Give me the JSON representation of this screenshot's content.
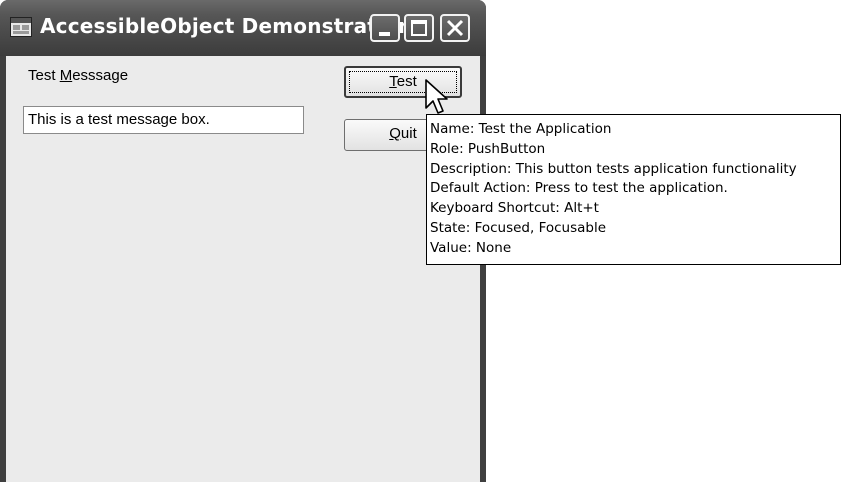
{
  "window": {
    "title": "AccessibleObject Demonstration"
  },
  "form": {
    "label_prefix": "Test ",
    "label_accel": "M",
    "label_rest": "esssage",
    "textbox_value": "This is a test message box.",
    "test_button_accel": "T",
    "test_button_rest": "est",
    "quit_button_accel": "Q",
    "quit_button_rest": "uit"
  },
  "tooltip": {
    "lines": [
      "Name: Test the Application",
      "Role: PushButton",
      "Description: This button tests application functionality",
      "Default Action: Press to test the application.",
      "Keyboard Shortcut: Alt+t",
      "State: Focused, Focusable",
      "Value: None"
    ]
  },
  "icons": {
    "app": "application-window-icon",
    "minimize": "minimize-icon",
    "maximize": "maximize-icon",
    "close": "close-icon",
    "cursor": "mouse-pointer-icon"
  }
}
